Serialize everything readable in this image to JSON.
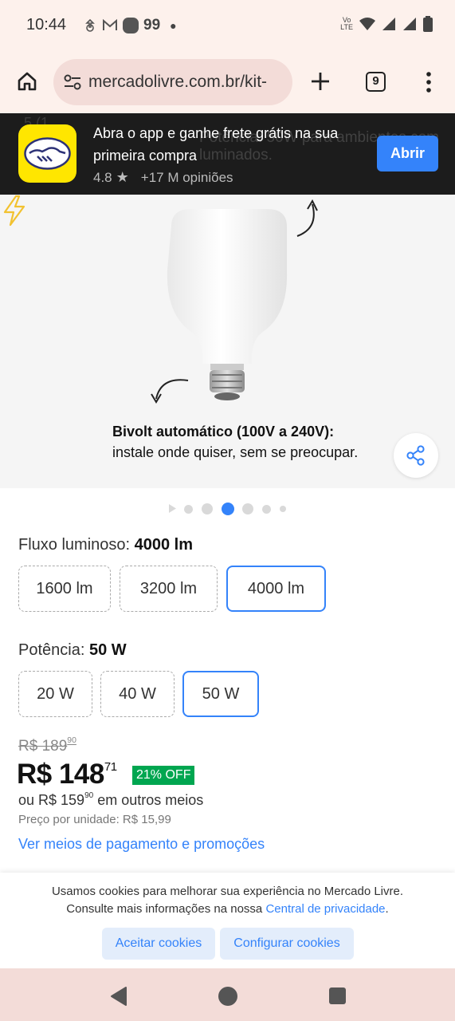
{
  "status_bar": {
    "time": "10:44",
    "notif_count": "99",
    "network_label_top": "Vo",
    "network_label_bottom": "LTE"
  },
  "browser": {
    "url": "mercadolivre.com.br/kit-",
    "tab_count": "9"
  },
  "app_banner": {
    "message": "Abra o app e ganhe frete grátis na sua primeira compra",
    "rating": "4.8",
    "reviews": "+17 M opiniões",
    "open_label": "Abrir",
    "background_text_1": "5 (1",
    "background_text_2": "Potência: 50W para ambientes com luminados."
  },
  "product_image": {
    "caption_bold": "Bivolt automático (100V a 240V):",
    "caption_rest": "instale onde quiser, sem se preocupar."
  },
  "carousel": {
    "total": 7,
    "active_index": 3
  },
  "variations": {
    "flux": {
      "label": "Fluxo luminoso:",
      "selected": "4000 lm",
      "options": [
        "1600 lm",
        "3200 lm",
        "4000 lm"
      ]
    },
    "power": {
      "label": "Potência:",
      "selected": "50 W",
      "options": [
        "20 W",
        "40 W",
        "50 W"
      ]
    }
  },
  "price": {
    "old_main": "R$ 189",
    "old_cents": "90",
    "new_main": "R$ 148",
    "new_cents": "71",
    "discount": "21% OFF",
    "other_prefix": "ou R$ 159",
    "other_cents": "90",
    "other_suffix": "em outros meios",
    "unit_price": "Preço por unidade: R$ 15,99",
    "payment_link": "Ver meios de pagamento e promoções"
  },
  "cookies": {
    "line1": "Usamos cookies para melhorar sua experiência no Mercado Livre.",
    "line2_prefix": "Consulte mais informações na nossa",
    "line2_link": "Central de privacidade",
    "accept_label": "Aceitar cookies",
    "configure_label": "Configurar cookies"
  },
  "colors": {
    "accent": "#3483fa",
    "discount_green": "#00a650",
    "brand_yellow": "#ffe600"
  }
}
